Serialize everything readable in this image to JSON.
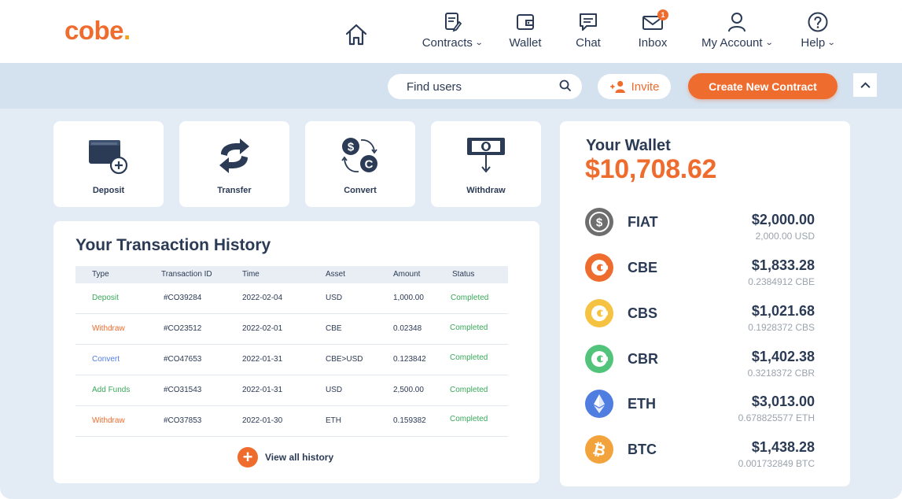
{
  "brand": {
    "name": "cobe",
    "dot": "."
  },
  "nav": {
    "home_icon": "home-icon",
    "items": [
      {
        "label": "Contracts",
        "icon": "contract-icon",
        "dropdown": true
      },
      {
        "label": "Wallet",
        "icon": "wallet-icon",
        "dropdown": false
      },
      {
        "label": "Chat",
        "icon": "chat-icon",
        "dropdown": false
      },
      {
        "label": "Inbox",
        "icon": "mail-icon",
        "dropdown": false,
        "badge": "1"
      },
      {
        "label": "My Account",
        "icon": "user-icon",
        "dropdown": true
      },
      {
        "label": "Help",
        "icon": "help-icon",
        "dropdown": true
      }
    ]
  },
  "actions": {
    "search_placeholder": "Find users",
    "invite_label": "Invite",
    "create_label": "Create New Contract"
  },
  "quick_actions": [
    {
      "label": "Deposit",
      "icon": "deposit-icon"
    },
    {
      "label": "Transfer",
      "icon": "transfer-icon"
    },
    {
      "label": "Convert",
      "icon": "convert-icon"
    },
    {
      "label": "Withdraw",
      "icon": "withdraw-icon"
    }
  ],
  "history": {
    "title": "Your Transaction History",
    "columns": [
      "Type",
      "Transaction ID",
      "Time",
      "Asset",
      "Amount",
      "Status"
    ],
    "rows": [
      {
        "type": "Deposit",
        "id": "#CO39284",
        "time": "2022-02-04",
        "asset": "USD",
        "amount": "1,000.00",
        "status": "Completed"
      },
      {
        "type": "Withdraw",
        "id": "#CO23512",
        "time": "2022-02-01",
        "asset": "CBE",
        "amount": "0.02348",
        "status": "Completed"
      },
      {
        "type": "Convert",
        "id": "#CO47653",
        "time": "2022-01-31",
        "asset": "CBE>USD",
        "amount": "0.123842",
        "status": "Completed"
      },
      {
        "type": "Add Funds",
        "id": "#CO31543",
        "time": "2022-01-31",
        "asset": "USD",
        "amount": "2,500.00",
        "status": "Completed"
      },
      {
        "type": "Withdraw",
        "id": "#CO37853",
        "time": "2022-01-30",
        "asset": "ETH",
        "amount": "0.159382",
        "status": "Completed"
      }
    ],
    "view_all_label": "View all history"
  },
  "wallet": {
    "title": "Your Wallet",
    "total": "$10,708.62",
    "assets": [
      {
        "name": "FIAT",
        "value": "$2,000.00",
        "sub": "2,000.00 USD",
        "icon": "dollar-coin-icon",
        "color": "#6e6e6e"
      },
      {
        "name": "CBE",
        "value": "$1,833.28",
        "sub": "0.2384912 CBE",
        "icon": "cbe-coin-icon",
        "color": "#ef6c2f"
      },
      {
        "name": "CBS",
        "value": "$1,021.68",
        "sub": "0.1928372 CBS",
        "icon": "cbs-coin-icon",
        "color": "#f5c341"
      },
      {
        "name": "CBR",
        "value": "$1,402.38",
        "sub": "0.3218372 CBR",
        "icon": "cbr-coin-icon",
        "color": "#52c37a"
      },
      {
        "name": "ETH",
        "value": "$3,013.00",
        "sub": "0.678825577 ETH",
        "icon": "ethereum-icon",
        "color": "#4f7de0"
      },
      {
        "name": "BTC",
        "value": "$1,438.28",
        "sub": "0.001732849 BTC",
        "icon": "bitcoin-icon",
        "color": "#f3a33b"
      }
    ]
  },
  "colors": {
    "accent": "#ef6c2f",
    "navy": "#2b3a55",
    "status_completed": "#39a85a",
    "type_deposit": "#39a85a",
    "type_withdraw": "#ef6c2f",
    "type_convert": "#4f7de0",
    "type_add_funds": "#39a85a"
  }
}
